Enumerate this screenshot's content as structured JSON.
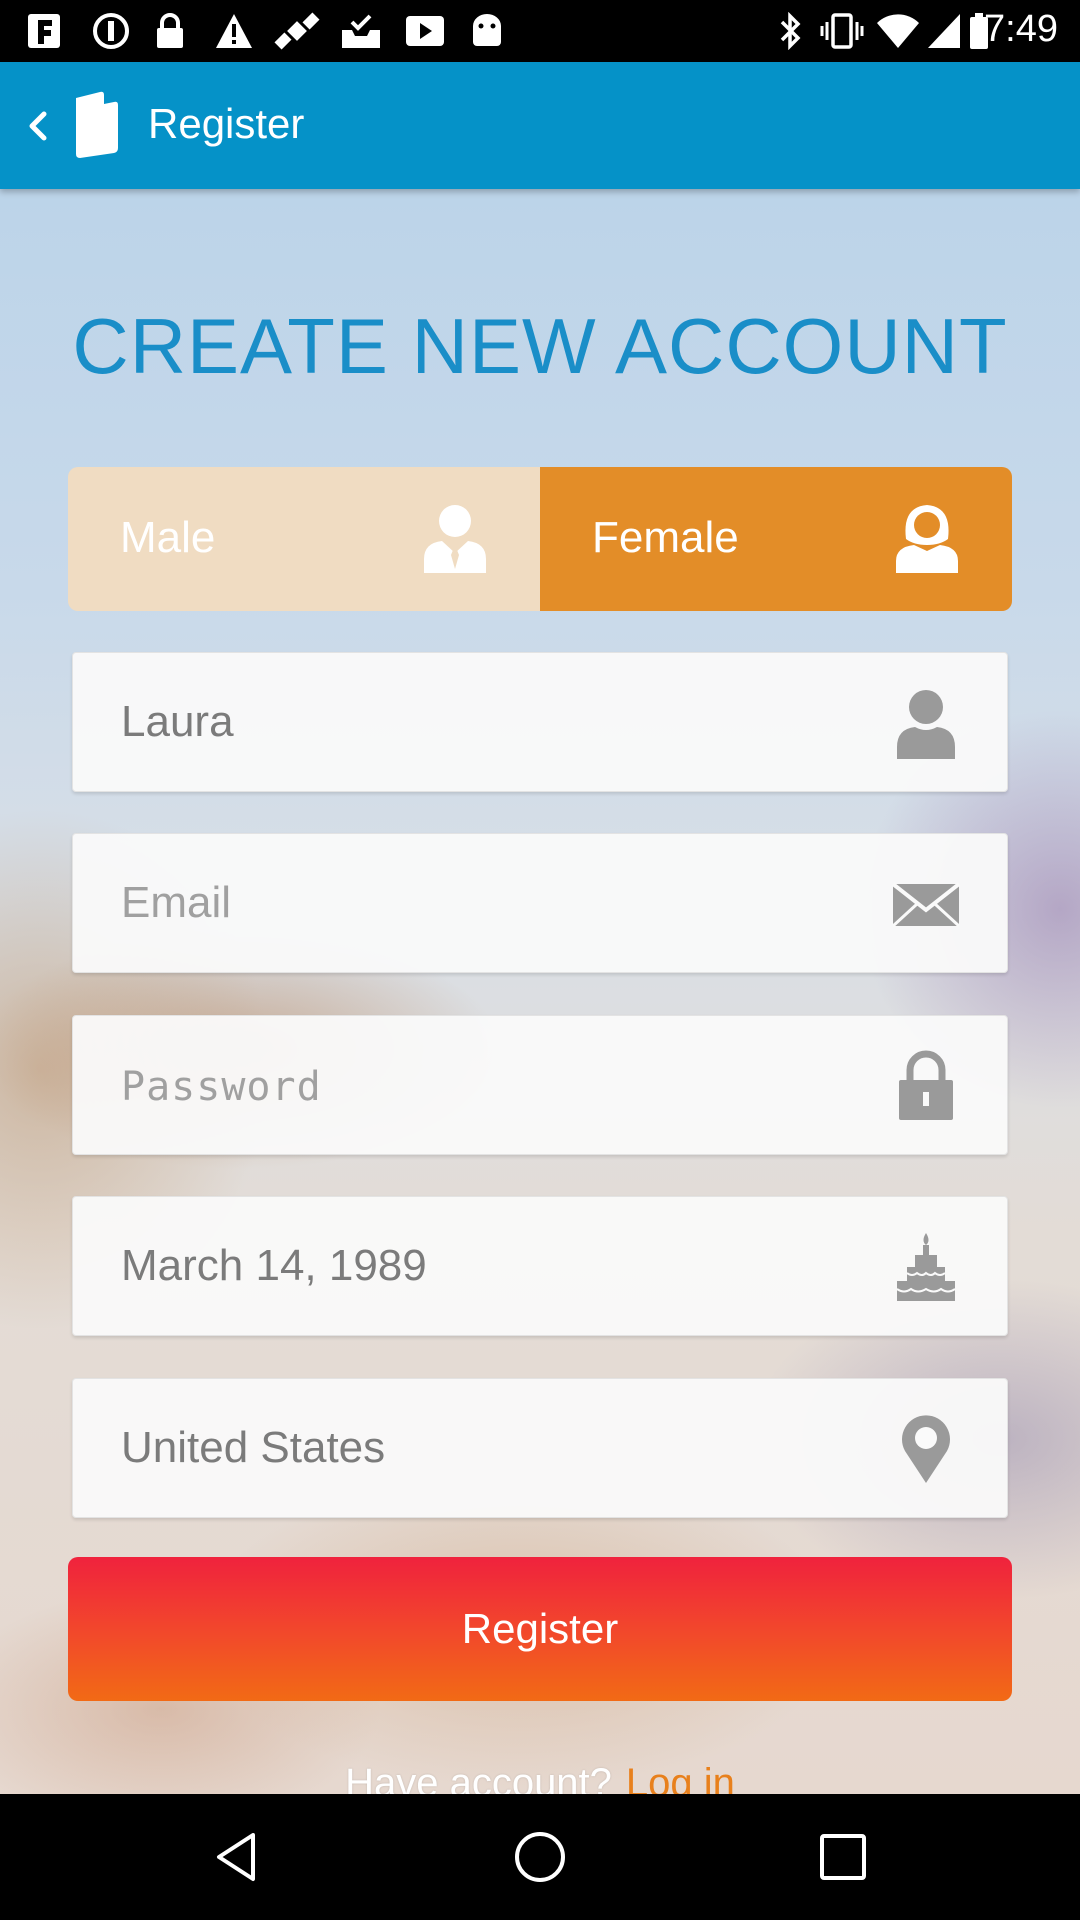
{
  "status_bar": {
    "time": "7:49",
    "left_icons": [
      "notification-f-icon",
      "sync-circle-icon",
      "lock-icon",
      "warning-icon",
      "satellite-icon",
      "inbox-check-icon",
      "play-icon",
      "android-icon"
    ],
    "right_icons": [
      "bluetooth-icon",
      "vibrate-icon",
      "wifi-icon",
      "signal-icon",
      "battery-icon"
    ]
  },
  "app_bar": {
    "title": "Register",
    "back_icon": "chevron-left-icon",
    "logo_icon": "app-logo-icon",
    "color": "#0592c8"
  },
  "form": {
    "headline": "CREATE NEW ACCOUNT",
    "gender": {
      "male_label": "Male",
      "female_label": "Female",
      "selected": "Female",
      "male_icon": "male-user-icon",
      "female_icon": "female-user-icon"
    },
    "fields": [
      {
        "name": "name",
        "value": "Laura",
        "placeholder": "",
        "icon": "person-icon"
      },
      {
        "name": "email",
        "value": "",
        "placeholder": "Email",
        "icon": "envelope-icon"
      },
      {
        "name": "password",
        "value": "",
        "placeholder": "Password",
        "icon": "lock-icon"
      },
      {
        "name": "birthday",
        "value": "March 14, 1989",
        "placeholder": "",
        "icon": "cake-icon"
      },
      {
        "name": "country",
        "value": "United States",
        "placeholder": "",
        "icon": "location-pin-icon"
      }
    ],
    "register_label": "Register",
    "have_account_text": "Have account?",
    "login_link": "Log in"
  },
  "colors": {
    "accent_blue": "#1a8ec8",
    "female_selected": "#e38d28",
    "male_unselected": "#f0dcc2",
    "register_red": "#f0223d",
    "register_orange": "#f26a15",
    "login_link": "#e8801c"
  },
  "nav_bar": {
    "back_icon": "triangle-back-icon",
    "home_icon": "circle-home-icon",
    "recents_icon": "square-recents-icon"
  }
}
